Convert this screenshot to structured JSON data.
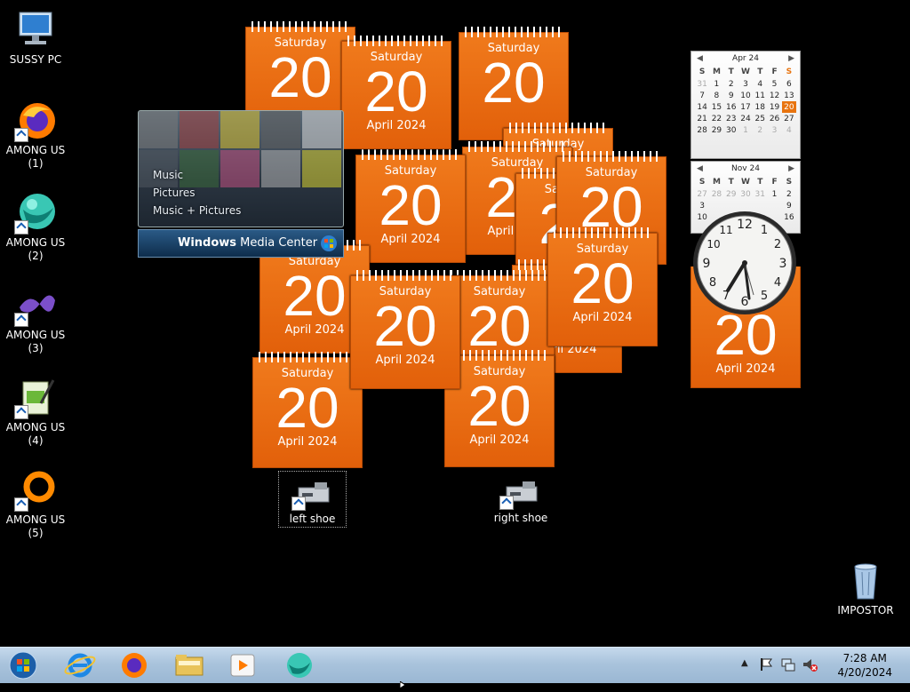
{
  "desktop_icons": [
    {
      "label": "SUSSY PC",
      "icon": "computer-icon"
    },
    {
      "label": "AMONG US (1)",
      "icon": "firefox-icon"
    },
    {
      "label": "AMONG US (2)",
      "icon": "globe-icon"
    },
    {
      "label": "AMONG US (3)",
      "icon": "visual-studio-icon"
    },
    {
      "label": "AMONG US (4)",
      "icon": "notepad-icon"
    },
    {
      "label": "AMONG US (5)",
      "icon": "ring-icon"
    },
    {
      "label": "left shoe",
      "icon": "usb-drive-icon"
    },
    {
      "label": "right shoe",
      "icon": "usb-drive-icon"
    },
    {
      "label": "IMPOSTOR",
      "icon": "recycle-bin-icon"
    }
  ],
  "calendar_gadget": {
    "day": "Saturday",
    "date": "20",
    "month_year": "April 2024"
  },
  "media_center": {
    "menu": [
      "Music",
      "Pictures",
      "Music + Pictures"
    ],
    "title_bold": "Windows",
    "title_rest": " Media Center"
  },
  "mini_calendar_1": {
    "month": "Apr 24",
    "weekdays": [
      "S",
      "M",
      "T",
      "W",
      "T",
      "F",
      "S"
    ],
    "weeks": [
      [
        "31",
        "1",
        "2",
        "3",
        "4",
        "5",
        "6"
      ],
      [
        "7",
        "8",
        "9",
        "10",
        "11",
        "12",
        "13"
      ],
      [
        "14",
        "15",
        "16",
        "17",
        "18",
        "19",
        "20"
      ],
      [
        "21",
        "22",
        "23",
        "24",
        "25",
        "26",
        "27"
      ],
      [
        "28",
        "29",
        "30",
        "1",
        "2",
        "3",
        "4"
      ]
    ],
    "today": "20"
  },
  "mini_calendar_2": {
    "month": "Nov 24",
    "weekdays": [
      "S",
      "M",
      "T",
      "W",
      "T",
      "F",
      "S"
    ],
    "weeks": [
      [
        "27",
        "28",
        "29",
        "30",
        "31",
        "1",
        "2"
      ],
      [
        "3",
        "",
        "",
        "",
        "",
        "",
        "9"
      ],
      [
        "10",
        "",
        "",
        "",
        "",
        "",
        "16"
      ]
    ]
  },
  "clock": {
    "numerals": [
      "12",
      "1",
      "2",
      "3",
      "4",
      "5",
      "6",
      "7",
      "8",
      "9",
      "10",
      "11"
    ]
  },
  "taskbar": {
    "apps": [
      "start-orb-icon",
      "internet-explorer-icon",
      "firefox-icon",
      "file-explorer-icon",
      "media-player-icon",
      "globe-icon"
    ],
    "time": "7:28 AM",
    "date": "4/20/2024"
  },
  "colors": {
    "calendar_orange": "#e8680f",
    "taskbar": "#b3cbe2",
    "desktop": "#000000"
  }
}
